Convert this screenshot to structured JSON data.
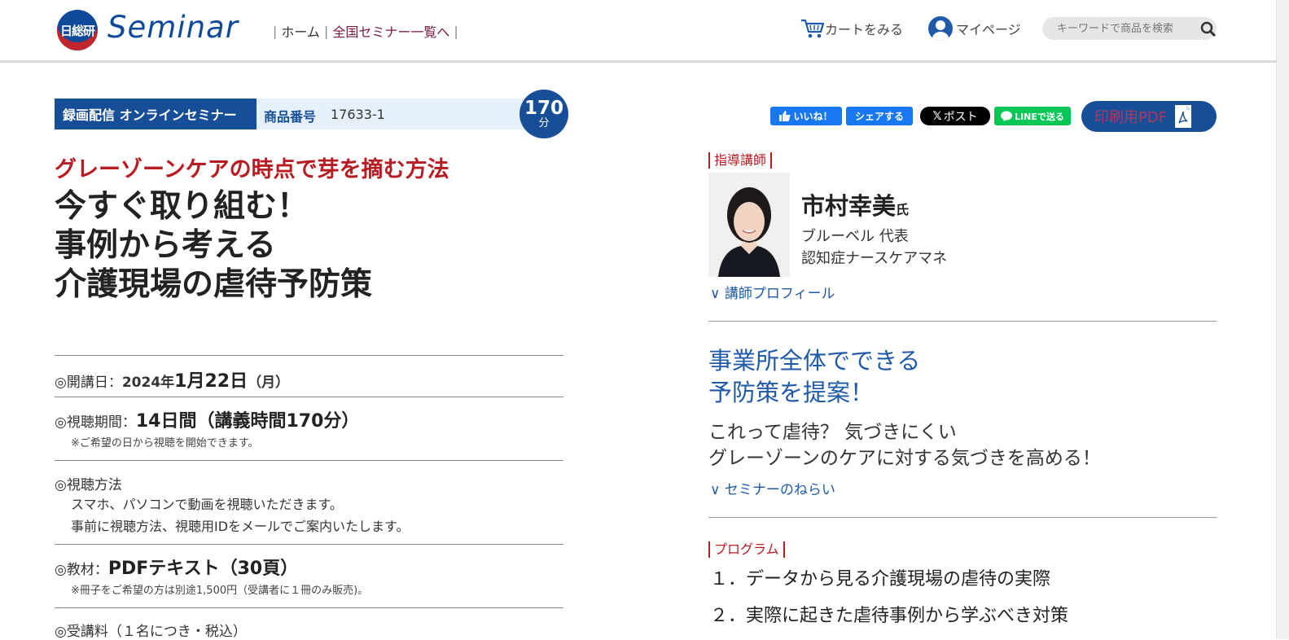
{
  "header": {
    "logo_text": "日総研",
    "brand": "Seminar",
    "nav": [
      "ホーム",
      "全国セミナー一覧へ"
    ],
    "cart_label": "カートをみる",
    "mypage_label": "マイページ",
    "search_placeholder": "キーワードで商品を検索"
  },
  "product": {
    "type_label": "録画配信 オンラインセミナー",
    "number_label": "商品番号",
    "number": "17633-1",
    "minutes": "170",
    "minutes_unit": "分",
    "subtitle": "グレーゾーンケアの時点で芽を摘む方法",
    "title_lines": [
      "今すぐ取り組む！",
      "事例から考える",
      "介護現場の虐待予防策"
    ]
  },
  "details": {
    "date_label": "◎開講日：",
    "date_prefix": "2024年",
    "date_main": "1月22日",
    "date_day": "（月）",
    "period_label": "◎視聴期間：",
    "period_value": "14日間（講義時間170分）",
    "period_note": "※ご希望の日から視聴を開始できます。",
    "method_label": "◎視聴方法",
    "method_lines": [
      "スマホ、パソコンで動画を視聴いただきます。",
      "事前に視聴方法、視聴用IDをメールでご案内いたします。"
    ],
    "material_label": "◎教材：",
    "material_value": "PDFテキスト（30頁）",
    "material_note": "※冊子をご希望の方は別途1,500円（受講者に１冊のみ販売)。",
    "fee_label": "◎受講料（１名につき・税込）"
  },
  "social": {
    "like": "いいね！",
    "share": "シェアする",
    "post": "ポスト",
    "line": "LINEで送る",
    "pdf": "印刷用PDF"
  },
  "instructor": {
    "section_label": "指導講師",
    "name": "市村幸美",
    "honorific": "氏",
    "role_lines": [
      "ブルーベル 代表",
      "認知症ナースケアマネ"
    ],
    "profile_link": "講師プロフィール"
  },
  "aim": {
    "heading_lines": [
      "事業所全体でできる",
      "予防策を提案！"
    ],
    "desc_lines": [
      "これって虐待？ 気づきにくい",
      "グレーゾーンのケアに対する気づきを高める！"
    ],
    "link": "セミナーのねらい"
  },
  "program": {
    "section_label": "プログラム",
    "items": [
      "１．データから見る介護現場の虐待の実際",
      "２．実際に起きた虐待事例から学ぶべき対策"
    ]
  },
  "colors": {
    "brand_blue": "#174e98",
    "accent_red": "#b81c22",
    "link_blue": "#1f5aa8",
    "fb_blue": "#1877f2",
    "line_green": "#06c755"
  }
}
